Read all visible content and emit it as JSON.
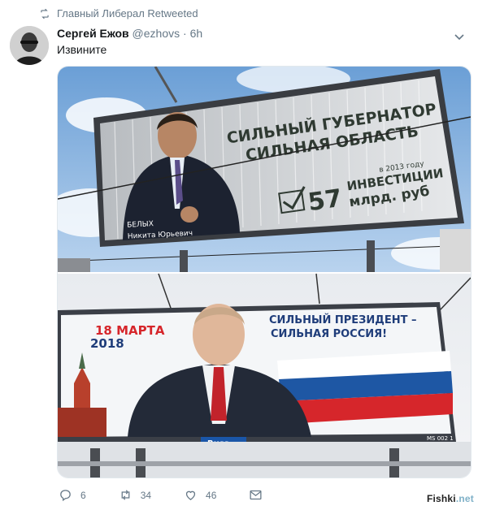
{
  "retweet": {
    "icon": "retweet-icon",
    "text": "Главный Либерал Retweeted"
  },
  "author": {
    "name": "Сергей Ежов",
    "handle": "@ezhovs",
    "separator": "·",
    "time": "6h"
  },
  "tweet_text": "Извините",
  "billboards": {
    "top": {
      "headline_1": "СИЛЬНЫЙ ГУБЕРНАТОР",
      "headline_2": "СИЛЬНАЯ ОБЛАСТЬ",
      "year_note": "в 2013 году",
      "number": "57",
      "investments": "ИНВЕСТИЦИИ",
      "amount": "млрд. руб",
      "surname": "БЕЛЫХ",
      "fullname": "Никита Юрьевич"
    },
    "bottom": {
      "date_1": "18 МАРТА",
      "date_2": "2018",
      "slogan_1": "СИЛЬНЫЙ ПРЕЗИДЕНТ –",
      "slogan_2": "СИЛЬНАЯ РОССИЯ!",
      "brand": "Russ",
      "plate": "MS 002 1"
    }
  },
  "actions": {
    "replies": "6",
    "retweets": "34",
    "likes": "46"
  },
  "watermark": {
    "main": "Fishki",
    "suffix": ".net"
  },
  "colors": {
    "muted": "#657786",
    "name": "#14171a",
    "border": "#e1e8ed",
    "red": "#d6262b",
    "navy": "#1f3d7a"
  }
}
